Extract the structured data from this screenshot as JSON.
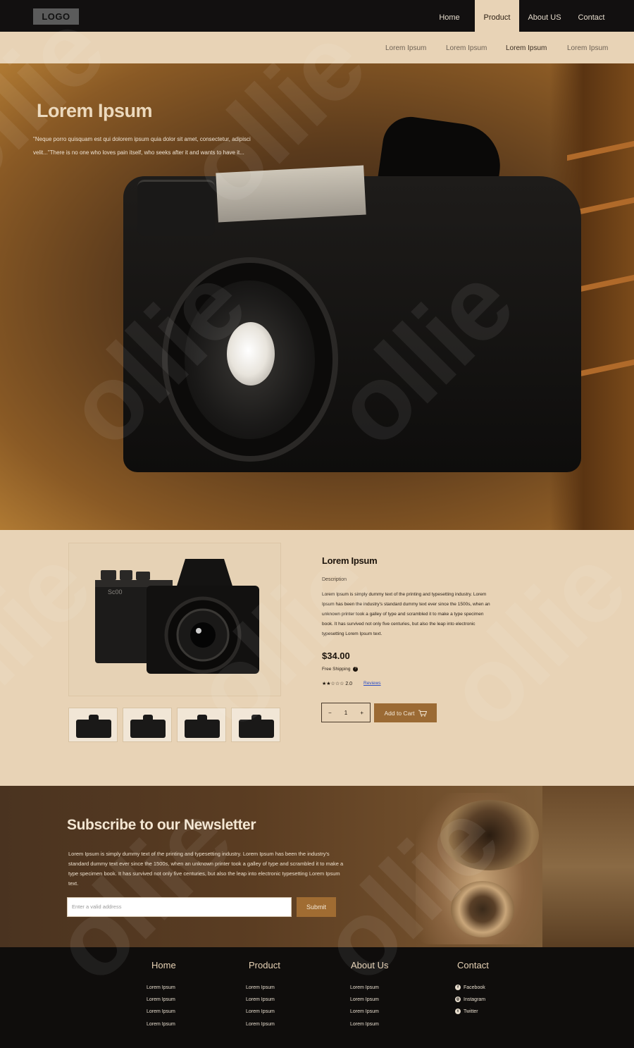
{
  "header": {
    "logo": "LOGO",
    "nav": [
      {
        "label": "Home",
        "active": false
      },
      {
        "label": "Product",
        "active": true
      },
      {
        "label": "About US",
        "active": false
      },
      {
        "label": "Contact",
        "active": false
      }
    ]
  },
  "subnav": {
    "items": [
      {
        "label": "Lorem Ipsum",
        "active": false
      },
      {
        "label": "Lorem Ipsum",
        "active": false
      },
      {
        "label": "Lorem Ipsum",
        "active": true
      },
      {
        "label": "Lorem Ipsum",
        "active": false
      }
    ]
  },
  "hero": {
    "title": "Lorem Ipsum",
    "text": "\"Neque porro quisquam est qui dolorem ipsum quia dolor sit amet, consectetur, adipisci velit...\"There is no one who loves pain itself, who seeks after it and wants to have it..."
  },
  "product": {
    "title": "Lorem Ipsum",
    "description_label": "Description",
    "description": "Lorem Ipsum is simply dummy text of the printing and typesetting industry. Lorem Ipsum has been the industry's standard dummy text ever since the 1500s, when an unknown printer took a galley of type and scrambled it to make a type specimen book. It has survived not only five centuries, but also the leap into electronic typesetting Lorem Ipsum text.",
    "price": "$34.00",
    "shipping": "Free Shipping",
    "rating_stars": "★★☆☆☆",
    "rating_value": "2.0",
    "reviews_label": "Reviews",
    "quantity": "1",
    "minus": "−",
    "plus": "+",
    "add_to_cart": "Add to Cart",
    "cart_icon": "🛒"
  },
  "newsletter": {
    "title": "Subscribe to our Newsletter",
    "text": "Lorem Ipsum is simply dummy text of the printing and typesetting industry. Lorem Ipsum has been the industry's standard dummy text ever since the 1500s, when an unknown printer took a galley of type and scrambled it to make a type specimen book. It has survived not only five centuries, but also the leap into electronic typesetting Lorem Ipsum text.",
    "input_placeholder": "Enter a valid address",
    "submit": "Submit"
  },
  "footer": {
    "columns": [
      {
        "title": "Home",
        "links": [
          "Lorem Ipsum",
          "Lorem Ipsum",
          "Lorem Ipsum",
          "Lorem Ipsum"
        ]
      },
      {
        "title": "Product",
        "links": [
          "Lorem Ipsum",
          "Lorem Ipsum",
          "Lorem Ipsum",
          "Lorem Ipsum"
        ]
      },
      {
        "title": "About Us",
        "links": [
          "Lorem Ipsum",
          "Lorem Ipsum",
          "Lorem Ipsum",
          "Lorem Ipsum"
        ]
      }
    ],
    "contact": {
      "title": "Contact",
      "social": [
        {
          "label": "Facebook",
          "icon": "f"
        },
        {
          "label": "Instagram",
          "icon": "◎"
        },
        {
          "label": "Twitter",
          "icon": "t"
        }
      ]
    }
  },
  "watermark": "ollie",
  "colors": {
    "accent": "#9b6a34",
    "page_bg": "#e8d3b6",
    "nav_bg": "#121010",
    "footer_bg": "#0f0d0c"
  }
}
